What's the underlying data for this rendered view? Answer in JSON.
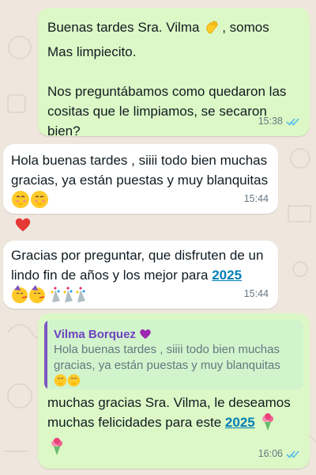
{
  "messages": [
    {
      "text_1": "Buenas tardes Sra. Vilma ",
      "text_2": ", somos\nMas limpiecito.\n\nNos preguntábamos como quedaron las cositas que le limpiamos, se secaron bien?",
      "time": "15:38",
      "status": "read",
      "emoji": "waving-hand"
    },
    {
      "text": "Hola buenas tardes , siiii todo bien muchas gracias, ya están puestas y muy blanquitas ",
      "time": "15:44",
      "emoji": "hand-over-mouth x2",
      "reaction": "heart"
    },
    {
      "text": "Gracias por preguntar, que disfruten de un lindo fin de años y los mejor para ",
      "year": "2025",
      "time": "15:44",
      "emoji": "partying-face x2, confetti x3"
    },
    {
      "quote_author": "Vilma Borquez ",
      "quote_text": "Hola buenas tardes , siiii todo bien muchas gracias, ya están puestas y muy blanquitas",
      "text_1": "muchas gracias Sra. Vilma, le deseamos muchas felicidades para este ",
      "year": "2025",
      "time": "16:06",
      "status": "read",
      "emoji": "bouquet x2, purple-heart"
    }
  ],
  "colors": {
    "outgoing_bubble": "#dcf8c6",
    "incoming_bubble": "#ffffff",
    "read_ticks": "#53bdeb",
    "link": "#027eb5",
    "quote_author": "#6f42c1",
    "wallpaper": "#efe7de"
  }
}
